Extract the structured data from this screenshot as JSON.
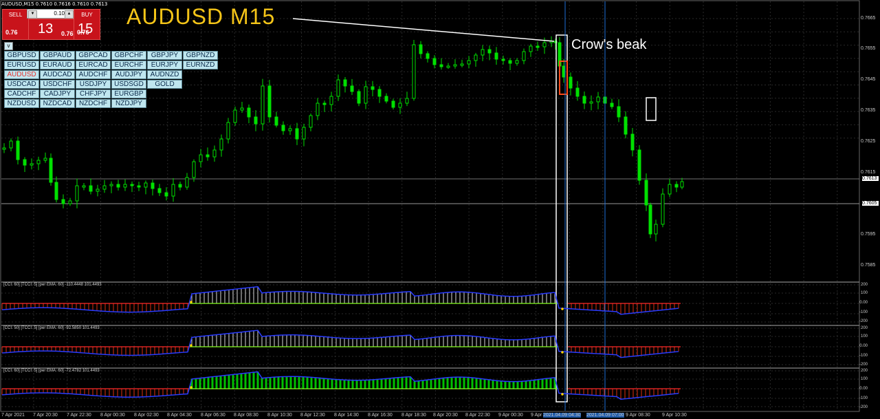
{
  "window": {
    "title": "AUDUSD,M15  0.7610 0.7616 0.7610 0.7613"
  },
  "trade_panel": {
    "sell_label": "SELL",
    "buy_label": "BUY",
    "lot": "0.10",
    "sell_small": "0.76",
    "sell_big": "13",
    "buy_small": "0.76",
    "buy_big": "15"
  },
  "symbols": {
    "toggle_label": "v",
    "rows": [
      [
        "GBPUSD",
        "GBPAUD",
        "GBPCAD",
        "GBPCHF",
        "GBPJPY",
        "GBPNZD"
      ],
      [
        "EURUSD",
        "EURAUD",
        "EURCAD",
        "EURCHF",
        "EURJPY",
        "EURNZD"
      ],
      [
        "AUDUSD",
        "AUDCAD",
        "AUDCHF",
        "AUDJPY",
        "AUDNZD"
      ],
      [
        "USDCAD",
        "USDCHF",
        "USDJPY",
        "USDSGD",
        "GOLD"
      ],
      [
        "CADCHF",
        "CADJPY",
        "CHFJPY",
        "EURGBP"
      ],
      [
        "NZDUSD",
        "NZDCAD",
        "NZDCHF",
        "NZDJPY"
      ]
    ],
    "active": "AUDUSD"
  },
  "annotations": {
    "title": "AUDUSD M15",
    "crow": "Crow's beak"
  },
  "price_axis": {
    "labels": [
      "0.7665",
      "0.7655",
      "0.7645",
      "0.7635",
      "0.7625",
      "0.7615",
      "0.7595",
      "0.7585"
    ],
    "bid_tag": "0.7613",
    "line_tag": "0.7605"
  },
  "indicators": [
    {
      "label": "[CCI: 60] [TCCI: 5] [per EMA: 60]  -110.4448 101.4493",
      "scale": [
        "200",
        "100",
        "0.00",
        "-100",
        "-200"
      ]
    },
    {
      "label": "[CCI: 50] [TCCI: 5] [per EMA: 60]  -92.5850 101.4493",
      "scale": [
        "200",
        "100",
        "0.00",
        "-100",
        "-200"
      ]
    },
    {
      "label": "[CCI: 60] [TCCI: 5] [per EMA: 60]  -72.4782 101.4493",
      "scale": [
        "200",
        "100",
        "0.00",
        "-100",
        "-200"
      ]
    }
  ],
  "time_axis": {
    "labels": [
      "7 Apr 2021",
      "7 Apr 20:30",
      "7 Apr 22:30",
      "8 Apr 00:30",
      "8 Apr 02:30",
      "8 Apr 04:30",
      "8 Apr 06:30",
      "8 Apr 08:30",
      "8 Apr 10:30",
      "8 Apr 12:30",
      "8 Apr 14:30",
      "8 Apr 16:30",
      "8 Apr 18:30",
      "8 Apr 20:30",
      "8 Apr 22:30",
      "9 Apr 00:30",
      "9 Apr 02:30",
      "2021.04.09 04:30",
      "2021.04.09 07:00",
      "9 Apr 08:30",
      "9 Apr 10:30"
    ],
    "highlighted": [
      "2021.04.09 04:30",
      "2021.04.09 07:00"
    ]
  },
  "colors": {
    "bull": "#00e000",
    "bear": "#00e000",
    "grid": "#2a2a2a",
    "red_hist": "#e03010",
    "green_hist": "#00c000",
    "blue_line": "#2a3cff",
    "ema": "#88ff22",
    "title": "#f5c518",
    "vline": "#1e6fd8",
    "red_box": "#ff4a1a"
  }
}
